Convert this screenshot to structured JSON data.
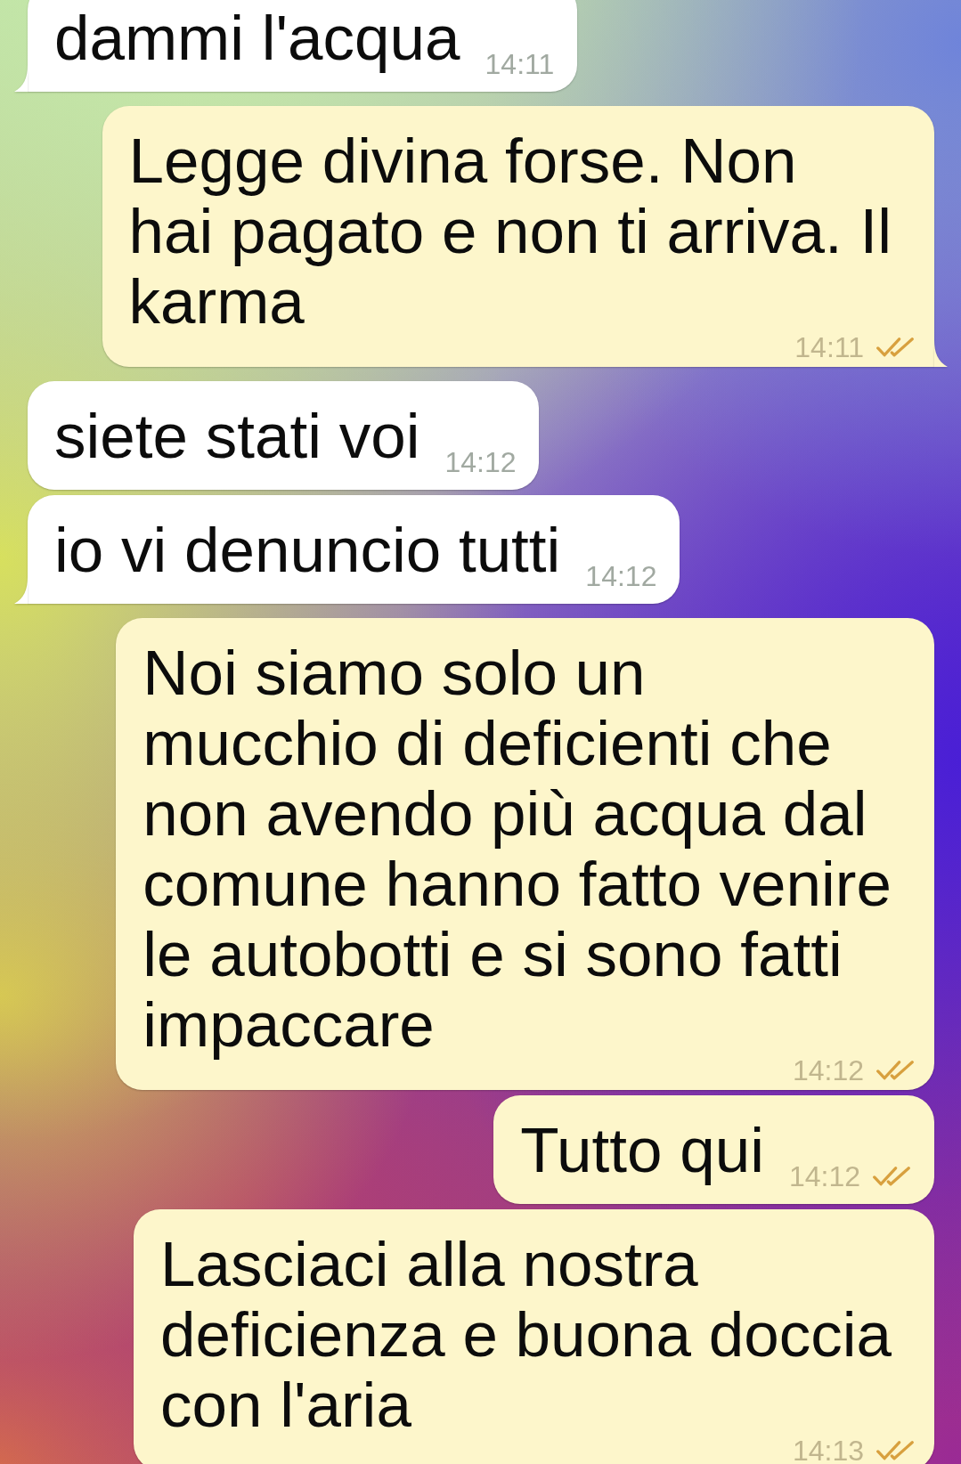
{
  "messages": [
    {
      "kind": "incoming",
      "text": "dammi l'acqua",
      "time": "14:11",
      "tail": true
    },
    {
      "kind": "outgoing",
      "text": "Legge divina forse. Non\nhai pagato e non ti arriva. Il\nkarma",
      "time": "14:11",
      "read": true,
      "tail": true
    },
    {
      "kind": "incoming",
      "text": "siete stati voi",
      "time": "14:12",
      "tail": false
    },
    {
      "kind": "incoming",
      "text": "io vi denuncio tutti",
      "time": "14:12",
      "tail": true
    },
    {
      "kind": "outgoing",
      "text": "Noi siamo solo un\nmucchio di deficienti che\nnon avendo più acqua dal\ncomune hanno fatto venire\nle autobotti e si sono fatti\nimpaccare",
      "time": "14:12",
      "read": true,
      "tail": false
    },
    {
      "kind": "outgoing",
      "text": "Tutto qui",
      "time": "14:12",
      "read": true,
      "tail": false
    },
    {
      "kind": "outgoing",
      "text": "Lasciaci alla nostra\ndeficienza e buona doccia\ncon l'aria",
      "time": "14:13",
      "read": true,
      "tail": false
    }
  ]
}
